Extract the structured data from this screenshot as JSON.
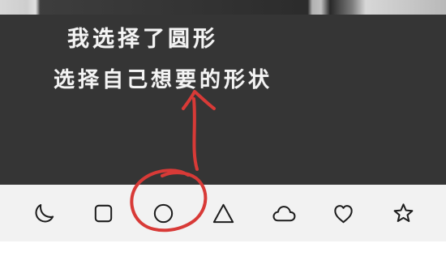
{
  "annotation": {
    "line_1": "我选择了圆形",
    "line_2": "选择自己想要的形状",
    "color": "#f4f4f4",
    "arrow_color": "#d83a37"
  },
  "toolbar": {
    "background": "#f2f2f2",
    "icon_color": "#1d1d1d",
    "selected_shape": "circle",
    "shapes": [
      {
        "name": "moon",
        "icon": "moon-icon"
      },
      {
        "name": "rounded-square",
        "icon": "rounded-square-icon"
      },
      {
        "name": "circle",
        "icon": "circle-icon"
      },
      {
        "name": "triangle",
        "icon": "triangle-icon"
      },
      {
        "name": "cloud",
        "icon": "cloud-icon"
      },
      {
        "name": "heart",
        "icon": "heart-icon"
      },
      {
        "name": "star",
        "icon": "star-icon"
      }
    ]
  },
  "photo": {
    "background": "#353535"
  }
}
